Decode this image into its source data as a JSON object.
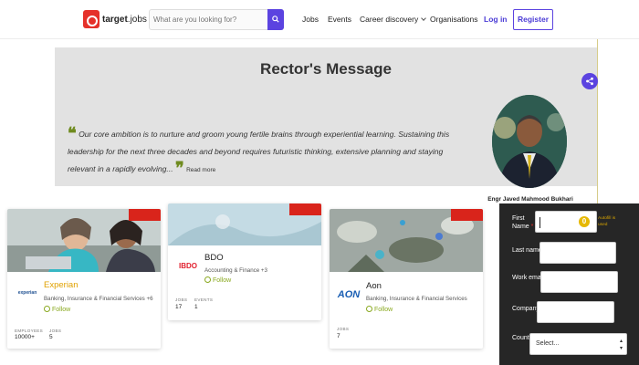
{
  "nav": {
    "logo_text_bold": "target",
    "logo_text_rest": "jobs",
    "search": {
      "placeholder": "What are you looking for?"
    },
    "links": [
      {
        "label": "Jobs"
      },
      {
        "label": "Events"
      },
      {
        "label": "Career discovery"
      },
      {
        "label": "Organisations"
      }
    ],
    "login": "Log in",
    "register": "Register",
    "accent": "#5b43e0"
  },
  "banner": {
    "title": "Rector's Message",
    "quote": "Our core ambition is to nurture and groom young fertile brains through experiential learning. Sustaining this leadership for the next three decades and beyond requires futuristic thinking, extensive planning and staying relevant in a rapidly evolving...",
    "read_more": "Read more",
    "person_name": "Engr Javed Mahmood Bukhari"
  },
  "cards": [
    {
      "name": "Experian",
      "logo": "experian",
      "sector": "Banking, Insurance & Financial Services +6",
      "follow": "Follow",
      "stats": [
        {
          "label": "EMPLOYEES",
          "value": "10000+"
        },
        {
          "label": "JOBS",
          "value": "5"
        }
      ]
    },
    {
      "name": "BDO",
      "logo": "IBDO",
      "sector": "Accounting & Finance +3",
      "follow": "Follow",
      "stats": [
        {
          "label": "JOBS",
          "value": "17"
        },
        {
          "label": "EVENTS",
          "value": "1"
        }
      ]
    },
    {
      "name": "Aon",
      "logo": "AON",
      "sector": "Banking, Insurance & Financial Services",
      "follow": "Follow",
      "stats": [
        {
          "label": "JOBS",
          "value": "7"
        }
      ]
    }
  ],
  "form": {
    "fields": [
      {
        "label_top": "First",
        "label_bottom": "Name",
        "required": "*"
      },
      {
        "label_top": "Last name",
        "label_bottom": "",
        "required": "*"
      },
      {
        "label_top": "Work email",
        "label_bottom": "",
        "required": "*"
      },
      {
        "label_top": "Company",
        "label_bottom": "",
        "required": ""
      },
      {
        "label_top": "Country",
        "label_bottom": "",
        "required": "*"
      }
    ],
    "first_name_badge": "0",
    "hint": "Autofill is used",
    "country_select": "Select..."
  },
  "colors": {
    "brand_red": "#e5312a",
    "follow_green": "#8aa920",
    "form_bg": "#262626"
  }
}
